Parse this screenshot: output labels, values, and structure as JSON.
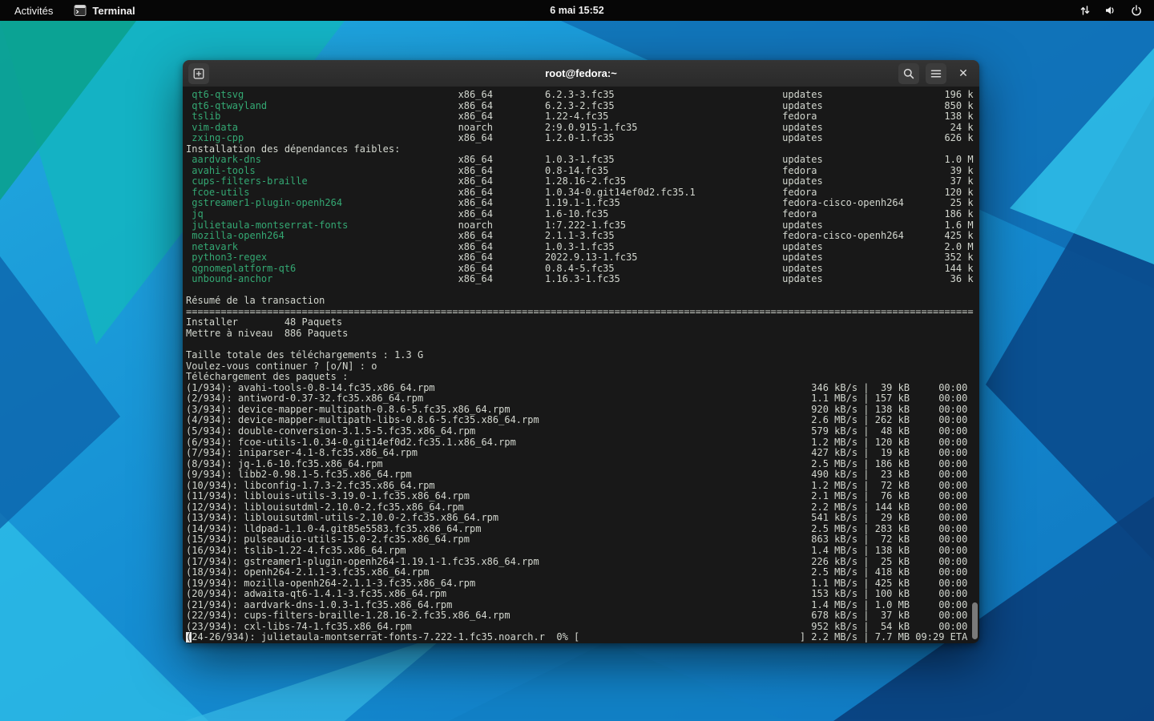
{
  "colors": {
    "terminal_bg": "#181818",
    "terminal_fg": "#d3d7cf",
    "terminal_green": "#34a873",
    "topbar_bg": "#060606"
  },
  "topbar": {
    "activities": "Activités",
    "app": "Terminal",
    "clock": "6 mai 15:52"
  },
  "window": {
    "title": "root@fedora:~"
  },
  "icons": {
    "close": "✕",
    "names": [
      "new-tab-icon",
      "search-icon",
      "menu-icon",
      "close-icon",
      "terminal-app-icon",
      "network-icon",
      "volume-icon",
      "power-icon"
    ]
  },
  "terminal": {
    "pkg_rows_top": [
      {
        "name": "qt6-qtsvg",
        "arch": "x86_64",
        "version": "6.2.3-3.fc35",
        "repo": "updates",
        "size": "196 k"
      },
      {
        "name": "qt6-qtwayland",
        "arch": "x86_64",
        "version": "6.2.3-2.fc35",
        "repo": "updates",
        "size": "850 k"
      },
      {
        "name": "tslib",
        "arch": "x86_64",
        "version": "1.22-4.fc35",
        "repo": "fedora",
        "size": "138 k"
      },
      {
        "name": "vim-data",
        "arch": "noarch",
        "version": "2:9.0.915-1.fc35",
        "repo": "updates",
        "size": "24 k"
      },
      {
        "name": "zxing-cpp",
        "arch": "x86_64",
        "version": "1.2.0-1.fc35",
        "repo": "updates",
        "size": "626 k"
      }
    ],
    "weak_header": "Installation des dépendances faibles:",
    "weak_rows": [
      {
        "name": "aardvark-dns",
        "arch": "x86_64",
        "version": "1.0.3-1.fc35",
        "repo": "updates",
        "size": "1.0 M"
      },
      {
        "name": "avahi-tools",
        "arch": "x86_64",
        "version": "0.8-14.fc35",
        "repo": "fedora",
        "size": "39 k"
      },
      {
        "name": "cups-filters-braille",
        "arch": "x86_64",
        "version": "1.28.16-2.fc35",
        "repo": "updates",
        "size": "37 k"
      },
      {
        "name": "fcoe-utils",
        "arch": "x86_64",
        "version": "1.0.34-0.git14ef0d2.fc35.1",
        "repo": "fedora",
        "size": "120 k"
      },
      {
        "name": "gstreamer1-plugin-openh264",
        "arch": "x86_64",
        "version": "1.19.1-1.fc35",
        "repo": "fedora-cisco-openh264",
        "size": "25 k"
      },
      {
        "name": "jq",
        "arch": "x86_64",
        "version": "1.6-10.fc35",
        "repo": "fedora",
        "size": "186 k"
      },
      {
        "name": "julietaula-montserrat-fonts",
        "arch": "noarch",
        "version": "1:7.222-1.fc35",
        "repo": "updates",
        "size": "1.6 M"
      },
      {
        "name": "mozilla-openh264",
        "arch": "x86_64",
        "version": "2.1.1-3.fc35",
        "repo": "fedora-cisco-openh264",
        "size": "425 k"
      },
      {
        "name": "netavark",
        "arch": "x86_64",
        "version": "1.0.3-1.fc35",
        "repo": "updates",
        "size": "2.0 M"
      },
      {
        "name": "python3-regex",
        "arch": "x86_64",
        "version": "2022.9.13-1.fc35",
        "repo": "updates",
        "size": "352 k"
      },
      {
        "name": "qgnomeplatform-qt6",
        "arch": "x86_64",
        "version": "0.8.4-5.fc35",
        "repo": "updates",
        "size": "144 k"
      },
      {
        "name": "unbound-anchor",
        "arch": "x86_64",
        "version": "1.16.3-1.fc35",
        "repo": "updates",
        "size": "36 k"
      }
    ],
    "summary_title": "Résumé de la transaction",
    "install_line": "Installer        48 Paquets",
    "upgrade_line": "Mettre à niveau  886 Paquets",
    "total_line": "Taille totale des téléchargements : 1.3 G",
    "continue_line": "Voulez-vous continuer ? [o/N] : o",
    "download_header": "Téléchargement des paquets :",
    "downloads": [
      {
        "label": "(1/934): avahi-tools-0.8-14.fc35.x86_64.rpm",
        "speed": "346 kB/s",
        "size": "39 kB",
        "time": "00:00"
      },
      {
        "label": "(2/934): antiword-0.37-32.fc35.x86_64.rpm",
        "speed": "1.1 MB/s",
        "size": "157 kB",
        "time": "00:00"
      },
      {
        "label": "(3/934): device-mapper-multipath-0.8.6-5.fc35.x86_64.rpm",
        "speed": "920 kB/s",
        "size": "138 kB",
        "time": "00:00"
      },
      {
        "label": "(4/934): device-mapper-multipath-libs-0.8.6-5.fc35.x86_64.rpm",
        "speed": "2.6 MB/s",
        "size": "262 kB",
        "time": "00:00"
      },
      {
        "label": "(5/934): double-conversion-3.1.5-5.fc35.x86_64.rpm",
        "speed": "579 kB/s",
        "size": "48 kB",
        "time": "00:00"
      },
      {
        "label": "(6/934): fcoe-utils-1.0.34-0.git14ef0d2.fc35.1.x86_64.rpm",
        "speed": "1.2 MB/s",
        "size": "120 kB",
        "time": "00:00"
      },
      {
        "label": "(7/934): iniparser-4.1-8.fc35.x86_64.rpm",
        "speed": "427 kB/s",
        "size": "19 kB",
        "time": "00:00"
      },
      {
        "label": "(8/934): jq-1.6-10.fc35.x86_64.rpm",
        "speed": "2.5 MB/s",
        "size": "186 kB",
        "time": "00:00"
      },
      {
        "label": "(9/934): libb2-0.98.1-5.fc35.x86_64.rpm",
        "speed": "490 kB/s",
        "size": "23 kB",
        "time": "00:00"
      },
      {
        "label": "(10/934): libconfig-1.7.3-2.fc35.x86_64.rpm",
        "speed": "1.2 MB/s",
        "size": "72 kB",
        "time": "00:00"
      },
      {
        "label": "(11/934): liblouis-utils-3.19.0-1.fc35.x86_64.rpm",
        "speed": "2.1 MB/s",
        "size": "76 kB",
        "time": "00:00"
      },
      {
        "label": "(12/934): liblouisutdml-2.10.0-2.fc35.x86_64.rpm",
        "speed": "2.2 MB/s",
        "size": "144 kB",
        "time": "00:00"
      },
      {
        "label": "(13/934): liblouisutdml-utils-2.10.0-2.fc35.x86_64.rpm",
        "speed": "541 kB/s",
        "size": "29 kB",
        "time": "00:00"
      },
      {
        "label": "(14/934): lldpad-1.1.0-4.git85e5583.fc35.x86_64.rpm",
        "speed": "2.5 MB/s",
        "size": "283 kB",
        "time": "00:00"
      },
      {
        "label": "(15/934): pulseaudio-utils-15.0-2.fc35.x86_64.rpm",
        "speed": "863 kB/s",
        "size": "72 kB",
        "time": "00:00"
      },
      {
        "label": "(16/934): tslib-1.22-4.fc35.x86_64.rpm",
        "speed": "1.4 MB/s",
        "size": "138 kB",
        "time": "00:00"
      },
      {
        "label": "(17/934): gstreamer1-plugin-openh264-1.19.1-1.fc35.x86_64.rpm",
        "speed": "226 kB/s",
        "size": "25 kB",
        "time": "00:00"
      },
      {
        "label": "(18/934): openh264-2.1.1-3.fc35.x86_64.rpm",
        "speed": "2.5 MB/s",
        "size": "418 kB",
        "time": "00:00"
      },
      {
        "label": "(19/934): mozilla-openh264-2.1.1-3.fc35.x86_64.rpm",
        "speed": "1.1 MB/s",
        "size": "425 kB",
        "time": "00:00"
      },
      {
        "label": "(20/934): adwaita-qt6-1.4.1-3.fc35.x86_64.rpm",
        "speed": "153 kB/s",
        "size": "100 kB",
        "time": "00:00"
      },
      {
        "label": "(21/934): aardvark-dns-1.0.3-1.fc35.x86_64.rpm",
        "speed": "1.4 MB/s",
        "size": "1.0 MB",
        "time": "00:00"
      },
      {
        "label": "(22/934): cups-filters-braille-1.28.16-2.fc35.x86_64.rpm",
        "speed": "678 kB/s",
        "size": "37 kB",
        "time": "00:00"
      },
      {
        "label": "(23/934): cxl-libs-74-1.fc35.x86_64.rpm",
        "speed": "952 kB/s",
        "size": "54 kB",
        "time": "00:00"
      }
    ],
    "progress": {
      "prefix": "(24-26/934): julietaula-montserrat-fonts-7.222-1.fc35.noarch.r  0% [",
      "speed": "2.2 MB/s",
      "size": "7.7 MB",
      "eta": "09:29 ETA"
    }
  }
}
